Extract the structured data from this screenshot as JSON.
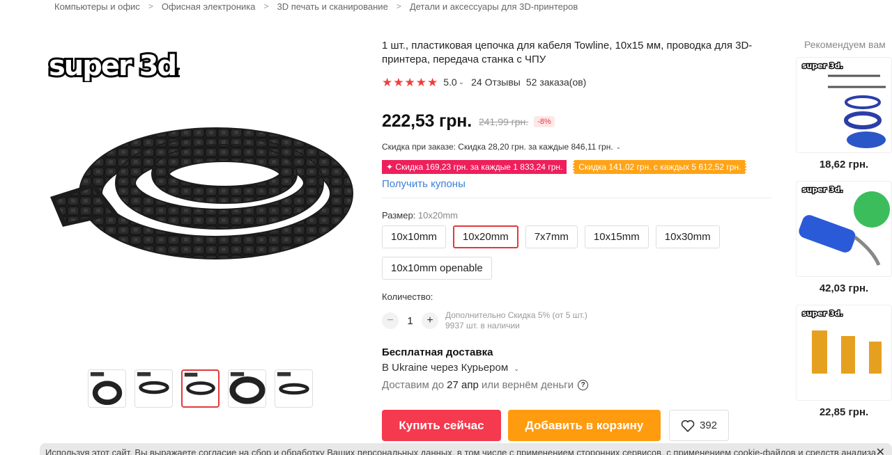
{
  "breadcrumb": [
    "Компьютеры и офис",
    "Офисная электроника",
    "3D печать и сканирование",
    "Детали и аксессуары для 3D-принтеров"
  ],
  "gallery": {
    "logo_text": "super 3d.",
    "thumbnail_count": 5,
    "active_thumbnail": 3
  },
  "product": {
    "title": "1 шт., пластиковая цепочка для кабеля Towline, 10x15 мм, проводка для 3D-принтера, передача станка с ЧПУ",
    "rating": "5.0",
    "rating_stars": 5,
    "reviews": "24 Отзывы",
    "orders": "52 заказа(ов)",
    "price": "222,53 грн.",
    "old_price": "241,99 грн.",
    "discount": "-8%",
    "order_discount": "Скидка при заказе: Скидка 28,20 грн. за каждые 846,11 грн.",
    "coupon_red": "✦ Скидка 169,23 грн. за каждые 1 833,24 грн.",
    "coupon_orange": "Скидка 141,02 грн. с каждых 5 612,52 грн.",
    "get_coupons": "Получить купоны"
  },
  "size": {
    "label": "Размер:",
    "selected": "10x20mm",
    "options": [
      "10x10mm",
      "10x20mm",
      "7x7mm",
      "10x15mm",
      "10x30mm",
      "10x10mm openable"
    ]
  },
  "quantity": {
    "label": "Количество:",
    "value": "1",
    "minus": "−",
    "plus": "+",
    "bulk_discount": "Дополнительно Скидка 5% (от 5 шт.)",
    "stock": "9937 шт. в наличии"
  },
  "shipping": {
    "title": "Бесплатная доставка",
    "method": "В Ukraine через Курьером",
    "delivery_prefix": "Доставим до",
    "delivery_date": "27 апр",
    "delivery_suffix": "или вернём деньги",
    "help": "?"
  },
  "actions": {
    "buy": "Купить сейчас",
    "cart": "Добавить в корзину",
    "wishlist_count": "392"
  },
  "recommendations": {
    "title": "Рекомендуем вам",
    "items": [
      {
        "price": "18,62 грн."
      },
      {
        "price": "42,03 грн."
      },
      {
        "price": "22,85 грн."
      }
    ]
  },
  "cookie_banner": {
    "text": "Используя этот сайт, Вы выражаете согласие на сбор и обработку Ваших персональных данных, в том числе с применением сторонних сервисов, с применением cookie-файлов и средств анализа",
    "close": "✕"
  },
  "colors": {
    "accent_red": "#f5394e",
    "accent_orange": "#ff9b0f",
    "star": "#f23d3d",
    "link": "#3b80d6"
  }
}
